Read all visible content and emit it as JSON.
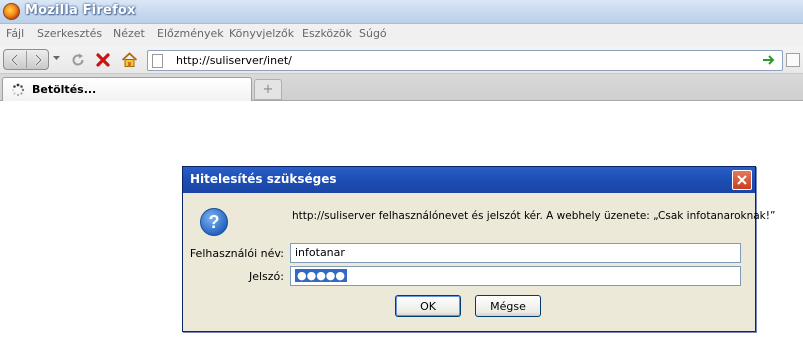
{
  "window": {
    "title": "Mozilla Firefox"
  },
  "menu": [
    "Fájl",
    "Szerkesztés",
    "Nézet",
    "Előzmények",
    "Könyvjelzők",
    "Eszközök",
    "Súgó"
  ],
  "navbar": {
    "url": "http://suliserver/inet/"
  },
  "tab": {
    "label": "Betöltés..."
  },
  "dialog": {
    "title": "Hitelesítés szükséges",
    "message": "http://suliserver felhasználónevet és jelszót kér. A webhely üzenete: „Csak infotanaroknak!”",
    "username_label": "Felhasználói név:",
    "username_value": "infotanar",
    "password_label": "Jelszó:",
    "password_value": "●●●●●",
    "ok_label": "OK",
    "cancel_label": "Mégse"
  },
  "colors": {
    "dialog_title": "#1e4fb6",
    "dialog_body": "#ece9d8",
    "stop": "#cc1111",
    "go": "#2e9a2e"
  }
}
